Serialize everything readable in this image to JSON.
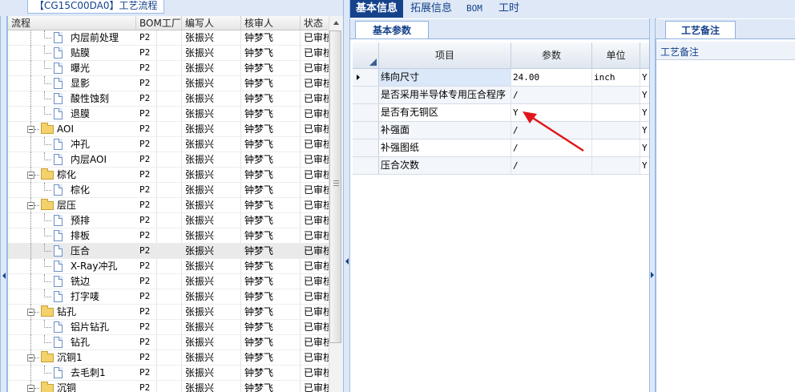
{
  "left_panel": {
    "title": "【CG15C00DA0】工艺流程",
    "columns": [
      "流程",
      "BOM工厂",
      "编写人",
      "核审人",
      "状态"
    ],
    "rows": [
      {
        "name": "内层前处理",
        "type": "leaf",
        "bom": "P2",
        "writer": "张振兴",
        "checker": "钟梦飞",
        "status": "已审核"
      },
      {
        "name": "贴膜",
        "type": "leaf",
        "bom": "P2",
        "writer": "张振兴",
        "checker": "钟梦飞",
        "status": "已审核"
      },
      {
        "name": "曝光",
        "type": "leaf",
        "bom": "P2",
        "writer": "张振兴",
        "checker": "钟梦飞",
        "status": "已审核"
      },
      {
        "name": "显影",
        "type": "leaf",
        "bom": "P2",
        "writer": "张振兴",
        "checker": "钟梦飞",
        "status": "已审核"
      },
      {
        "name": "酸性蚀刻",
        "type": "leaf",
        "bom": "P2",
        "writer": "张振兴",
        "checker": "钟梦飞",
        "status": "已审核"
      },
      {
        "name": "退膜",
        "type": "leaf",
        "bom": "P2",
        "writer": "张振兴",
        "checker": "钟梦飞",
        "status": "已审核"
      },
      {
        "name": "AOI",
        "type": "folder",
        "bom": "P2",
        "writer": "张振兴",
        "checker": "钟梦飞",
        "status": "已审核"
      },
      {
        "name": "冲孔",
        "type": "leaf",
        "bom": "P2",
        "writer": "张振兴",
        "checker": "钟梦飞",
        "status": "已审核"
      },
      {
        "name": "内层AOI",
        "type": "leaf",
        "bom": "P2",
        "writer": "张振兴",
        "checker": "钟梦飞",
        "status": "已审核"
      },
      {
        "name": "棕化",
        "type": "folder",
        "bom": "P2",
        "writer": "张振兴",
        "checker": "钟梦飞",
        "status": "已审核"
      },
      {
        "name": "棕化",
        "type": "leaf",
        "bom": "P2",
        "writer": "张振兴",
        "checker": "钟梦飞",
        "status": "已审核"
      },
      {
        "name": "层压",
        "type": "folder",
        "bom": "P2",
        "writer": "张振兴",
        "checker": "钟梦飞",
        "status": "已审核"
      },
      {
        "name": "预排",
        "type": "leaf",
        "bom": "P2",
        "writer": "张振兴",
        "checker": "钟梦飞",
        "status": "已审核"
      },
      {
        "name": "排板",
        "type": "leaf",
        "bom": "P2",
        "writer": "张振兴",
        "checker": "钟梦飞",
        "status": "已审核"
      },
      {
        "name": "压合",
        "type": "leaf",
        "bom": "P2",
        "writer": "张振兴",
        "checker": "钟梦飞",
        "status": "已审核",
        "selected": true
      },
      {
        "name": "X-Ray冲孔",
        "type": "leaf",
        "bom": "P2",
        "writer": "张振兴",
        "checker": "钟梦飞",
        "status": "已审核"
      },
      {
        "name": "铣边",
        "type": "leaf",
        "bom": "P2",
        "writer": "张振兴",
        "checker": "钟梦飞",
        "status": "已审核"
      },
      {
        "name": "打字唛",
        "type": "leaf",
        "bom": "P2",
        "writer": "张振兴",
        "checker": "钟梦飞",
        "status": "已审核"
      },
      {
        "name": "钻孔",
        "type": "folder",
        "bom": "P2",
        "writer": "张振兴",
        "checker": "钟梦飞",
        "status": "已审核"
      },
      {
        "name": "铝片钻孔",
        "type": "leaf",
        "bom": "P2",
        "writer": "张振兴",
        "checker": "钟梦飞",
        "status": "已审核"
      },
      {
        "name": "钻孔",
        "type": "leaf",
        "bom": "P2",
        "writer": "张振兴",
        "checker": "钟梦飞",
        "status": "已审核"
      },
      {
        "name": "沉铜1",
        "type": "folder",
        "bom": "P2",
        "writer": "张振兴",
        "checker": "钟梦飞",
        "status": "已审核"
      },
      {
        "name": "去毛刺1",
        "type": "leaf",
        "bom": "P2",
        "writer": "张振兴",
        "checker": "钟梦飞",
        "status": "已审核"
      },
      {
        "name": "沉铜",
        "type": "folder",
        "bom": "P2",
        "writer": "张振兴",
        "checker": "钟梦飞",
        "status": "已审核"
      }
    ]
  },
  "top_tabs": [
    "基本信息",
    "拓展信息",
    "BOM",
    "工时"
  ],
  "top_tab_active": 0,
  "params_panel": {
    "tab": "基本参数",
    "columns": [
      "项目",
      "参数",
      "单位"
    ],
    "rows": [
      {
        "name": "纬向尺寸",
        "value": "24.00",
        "unit": "inch",
        "extra": "Y",
        "current": true
      },
      {
        "name": "是否采用半导体专用压合程序",
        "value": "/",
        "unit": "",
        "extra": "Y"
      },
      {
        "name": "是否有无铜区",
        "value": "Y",
        "unit": "",
        "extra": "Y"
      },
      {
        "name": "补强面",
        "value": "/",
        "unit": "",
        "extra": "Y"
      },
      {
        "name": "补强图纸",
        "value": "/",
        "unit": "",
        "extra": "Y"
      },
      {
        "name": "压合次数",
        "value": "/",
        "unit": "",
        "extra": "Y"
      }
    ]
  },
  "notes_panel": {
    "tab": "工艺备注",
    "label": "工艺备注"
  },
  "colors": {
    "active_tab": "#15428b",
    "annotation_arrow": "#e0161b"
  }
}
